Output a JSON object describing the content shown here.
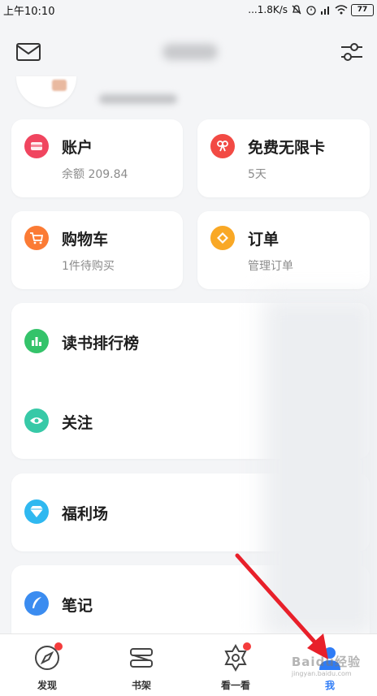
{
  "status_bar": {
    "time": "上午10:10",
    "network_speed": "...1.8K/s",
    "battery": "77"
  },
  "header": {
    "mail_icon": "mail-icon",
    "settings_icon": "settings-sliders-icon"
  },
  "cards": {
    "account": {
      "title": "账户",
      "subtitle": "余额 209.84",
      "icon": "wallet-icon",
      "color": "#f0455f"
    },
    "free_card": {
      "title": "免费无限卡",
      "subtitle": "5天",
      "icon": "ribbon-icon",
      "color": "#f24a44"
    },
    "cart": {
      "title": "购物车",
      "subtitle": "1件待购买",
      "icon": "cart-icon",
      "color": "#fb7b35"
    },
    "order": {
      "title": "订单",
      "subtitle": "管理订单",
      "icon": "order-icon",
      "color": "#f9a825"
    }
  },
  "list": {
    "ranking": {
      "label": "读书排行榜",
      "icon": "bar-chart-icon",
      "color": "#34c36a"
    },
    "follow": {
      "label": "关注",
      "icon": "eye-icon",
      "color": "#37c9a7"
    },
    "welfare": {
      "label": "福利场",
      "icon": "diamond-icon",
      "color": "#2fb8f0"
    },
    "notes": {
      "label": "笔记",
      "icon": "feather-icon",
      "color": "#3b8cf0"
    }
  },
  "bottom_nav": [
    {
      "label": "发现",
      "icon": "compass-icon",
      "badge": true
    },
    {
      "label": "书架",
      "icon": "bookshelf-icon",
      "badge": false
    },
    {
      "label": "看一看",
      "icon": "star-hexagon-icon",
      "badge": true
    },
    {
      "label": "我",
      "icon": "person-icon",
      "badge": false,
      "active": true
    }
  ],
  "colors": {
    "active_tab": "#2f7cf6",
    "badge": "#f43c3c",
    "annotation_arrow": "#e8202a"
  },
  "watermark": {
    "text": "Baidu经验",
    "sub": "jingyan.baidu.com"
  }
}
